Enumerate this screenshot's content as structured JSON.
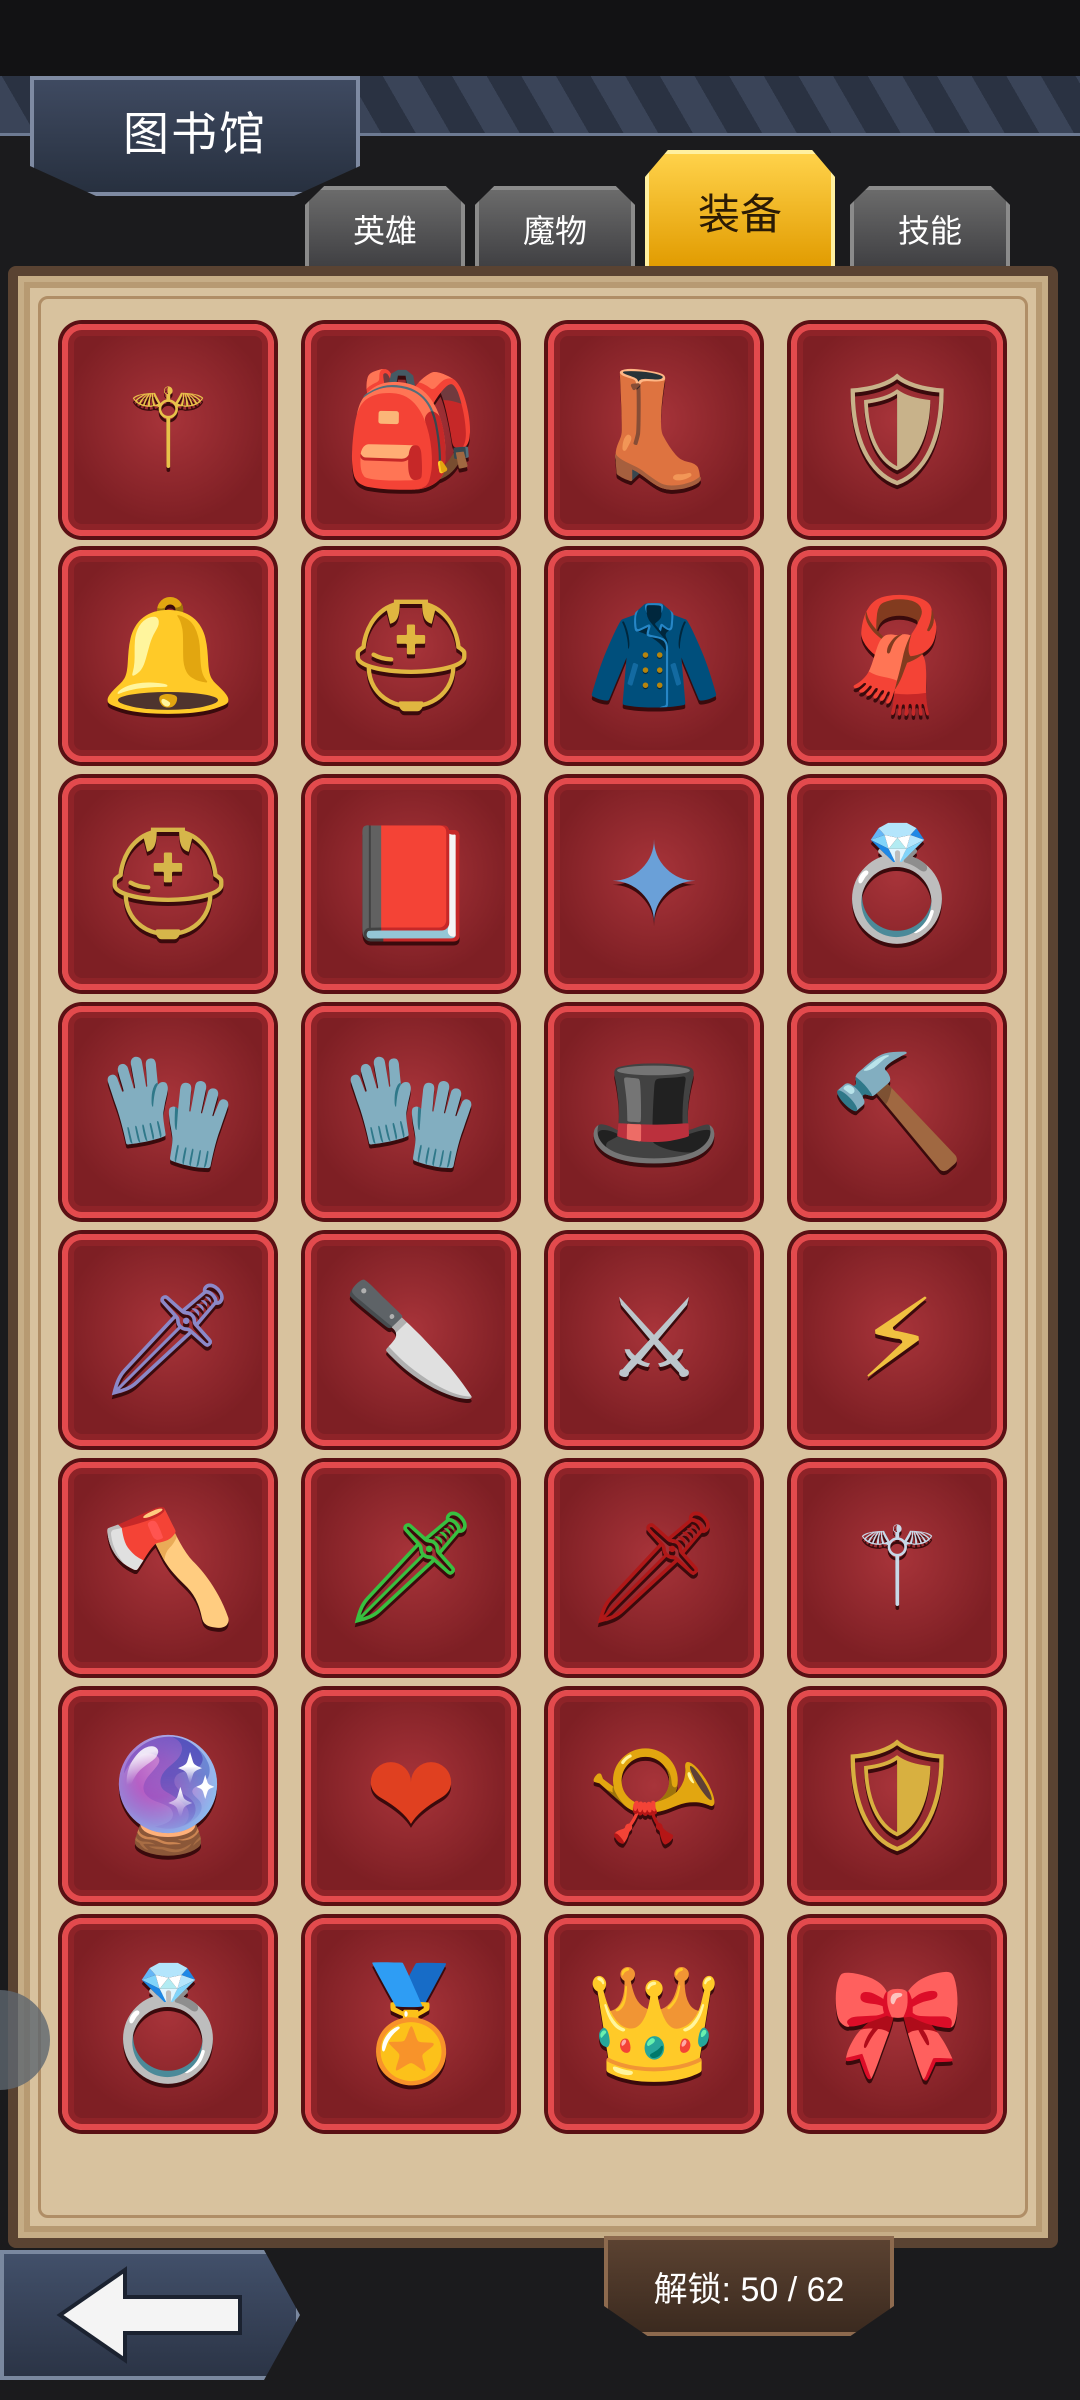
{
  "title": "图书馆",
  "tabs": [
    {
      "label": "英雄",
      "active": false
    },
    {
      "label": "魔物",
      "active": false
    },
    {
      "label": "装备",
      "active": true
    },
    {
      "label": "技能",
      "active": false
    }
  ],
  "items": [
    {
      "name": "winged-gold-staff",
      "glyph": "⚚",
      "color": "#e8c24a"
    },
    {
      "name": "leather-backpack",
      "glyph": "🎒",
      "color": "#c7992c"
    },
    {
      "name": "winged-boots",
      "glyph": "👢",
      "color": "#3f5fb8"
    },
    {
      "name": "lightning-shield",
      "glyph": "🛡",
      "color": "#c8b28a"
    },
    {
      "name": "silver-whistle",
      "glyph": "🔔",
      "color": "#d8dde2"
    },
    {
      "name": "golden-hood",
      "glyph": "⛑",
      "color": "#e0b640"
    },
    {
      "name": "fur-cloak",
      "glyph": "🧥",
      "color": "#d8413a"
    },
    {
      "name": "mantle",
      "glyph": "🧣",
      "color": "#ecd9b8"
    },
    {
      "name": "winged-helmet",
      "glyph": "⛑",
      "color": "#d6b64a"
    },
    {
      "name": "red-tome",
      "glyph": "📕",
      "color": "#d8343a"
    },
    {
      "name": "star-wand",
      "glyph": "✦",
      "color": "#6aa0d8"
    },
    {
      "name": "gem-ring",
      "glyph": "💍",
      "color": "#f0a020"
    },
    {
      "name": "frost-gauntlet",
      "glyph": "🧤",
      "color": "#9fc8e0"
    },
    {
      "name": "golden-gauntlet",
      "glyph": "🧤",
      "color": "#d8a82c"
    },
    {
      "name": "wizard-hat",
      "glyph": "🎩",
      "color": "#a27ac0"
    },
    {
      "name": "war-hammer",
      "glyph": "🔨",
      "color": "#9a8a70"
    },
    {
      "name": "crystal-sword",
      "glyph": "🗡",
      "color": "#8b88c8"
    },
    {
      "name": "poison-dagger",
      "glyph": "🔪",
      "color": "#d6dde0"
    },
    {
      "name": "bone-spear",
      "glyph": "⚔",
      "color": "#bcc6cc"
    },
    {
      "name": "thunder-dagger",
      "glyph": "⚡",
      "color": "#f0c040"
    },
    {
      "name": "blood-axe",
      "glyph": "🪓",
      "color": "#c0303a"
    },
    {
      "name": "emerald-blade",
      "glyph": "🗡",
      "color": "#38c040"
    },
    {
      "name": "crimson-sword",
      "glyph": "🗡",
      "color": "#b01818"
    },
    {
      "name": "flower-staff",
      "glyph": "⚚",
      "color": "#c8d8e8"
    },
    {
      "name": "storm-orb",
      "glyph": "🔮",
      "color": "#60b8f0"
    },
    {
      "name": "fire-heart",
      "glyph": "❤",
      "color": "#e04020"
    },
    {
      "name": "war-horn",
      "glyph": "📯",
      "color": "#e8d8b0"
    },
    {
      "name": "spiked-shield",
      "glyph": "🛡",
      "color": "#d8b040"
    },
    {
      "name": "pumpkin-ring",
      "glyph": "💍",
      "color": "#e88a20"
    },
    {
      "name": "laurel-emblem",
      "glyph": "🏅",
      "color": "#c0a060"
    },
    {
      "name": "jeweled-crown",
      "glyph": "👑",
      "color": "#c0c8d8"
    },
    {
      "name": "red-headband",
      "glyph": "🎀",
      "color": "#d83030"
    }
  ],
  "unlock": {
    "text": "解锁: 50 / 62"
  },
  "back": {
    "icon": "back-arrow-icon"
  }
}
